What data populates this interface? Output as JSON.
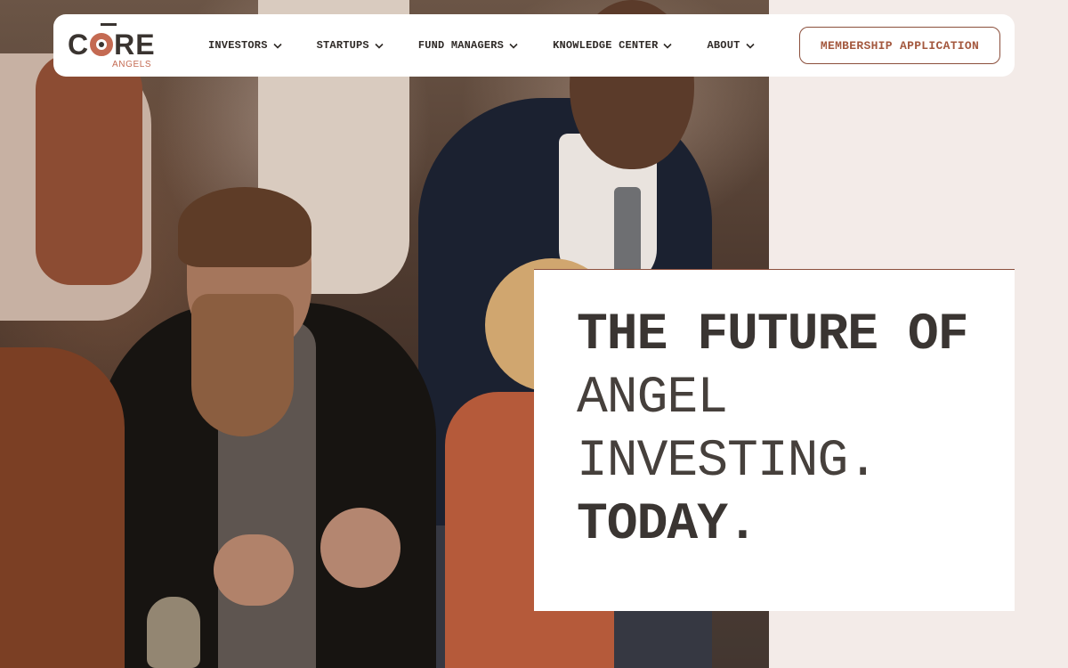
{
  "brand": {
    "name": "CORE",
    "tagline": "ANGELS",
    "colors": {
      "accent": "#c46a52",
      "text": "#3a3430",
      "cta": "#a4593f",
      "background": "#f3ebe8"
    }
  },
  "nav": {
    "items": [
      {
        "label": "INVESTORS",
        "icon": "chevron-down-icon"
      },
      {
        "label": "STARTUPS",
        "icon": "chevron-down-icon"
      },
      {
        "label": "FUND MANAGERS",
        "icon": "chevron-down-icon"
      },
      {
        "label": "KNOWLEDGE CENTER",
        "icon": "chevron-down-icon"
      },
      {
        "label": "ABOUT",
        "icon": "chevron-down-icon"
      }
    ],
    "cta_label": "MEMBERSHIP APPLICATION"
  },
  "hero": {
    "headline": {
      "line1": "THE FUTURE OF",
      "line2": "ANGEL",
      "line3": "INVESTING.",
      "line4": "TODAY."
    }
  }
}
